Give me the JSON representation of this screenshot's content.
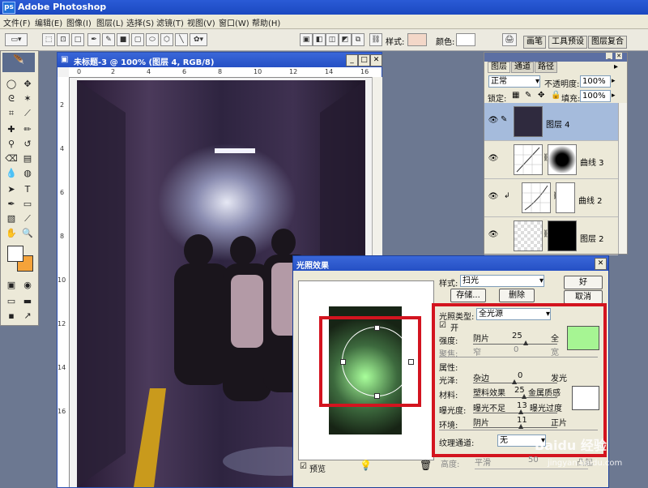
{
  "app": {
    "title": "Adobe Photoshop",
    "icon": "ps"
  },
  "menubar": {
    "items": [
      "文件(F)",
      "编辑(E)",
      "图像(I)",
      "图层(L)",
      "选择(S)",
      "滤镜(T)",
      "视图(V)",
      "窗口(W)",
      "帮助(H)"
    ]
  },
  "options_bar": {
    "style_label": "样式:",
    "color_label": "颜色:",
    "palette_tabs": [
      "画笔",
      "工具预设",
      "图层复合"
    ]
  },
  "document": {
    "title": "未标题-3 @ 100% (图层 4, RGB/8)",
    "ruler_h": [
      "0",
      "2",
      "4",
      "6",
      "8",
      "10",
      "12",
      "14",
      "16"
    ],
    "ruler_v": [
      "2",
      "4",
      "6",
      "8",
      "10",
      "12",
      "14",
      "16"
    ]
  },
  "layers_panel": {
    "tabs": [
      "图层",
      "通道",
      "路径"
    ],
    "blend_mode": "正常",
    "opacity_label": "不透明度:",
    "opacity_value": "100%",
    "lock_label": "锁定:",
    "fill_label": "填充:",
    "fill_value": "100%",
    "layers": [
      {
        "name": "图层 4",
        "selected": true
      },
      {
        "name": "曲线 3",
        "selected": false
      },
      {
        "name": "曲线 2",
        "selected": false
      },
      {
        "name": "图层 2",
        "selected": false
      }
    ]
  },
  "dialog": {
    "title": "光照效果",
    "style_label": "样式:",
    "style_value": "扫光",
    "save_button": "存储...",
    "delete_button": "删除",
    "ok_button": "好",
    "cancel_button": "取消",
    "light_type_label": "光照类型:",
    "light_type_value": "全光源",
    "on_label": "开",
    "intensity_label": "强度:",
    "intensity_left": "阴片",
    "intensity_value": "25",
    "intensity_right": "全",
    "focus_label": "聚焦:",
    "focus_left": "窄",
    "focus_value": "0",
    "focus_right": "宽",
    "properties_label": "属性:",
    "gloss_label": "光泽:",
    "gloss_left": "杂边",
    "gloss_value": "0",
    "gloss_right": "发光",
    "material_label": "材料:",
    "material_left": "塑料效果",
    "material_value": "25",
    "material_right": "金属质感",
    "exposure_label": "曝光度:",
    "exposure_left": "曝光不足",
    "exposure_value": "13",
    "exposure_right": "曝光过度",
    "ambience_label": "环境:",
    "ambience_left": "阴片",
    "ambience_value": "11",
    "ambience_right": "正片",
    "texture_label": "纹理通道:",
    "texture_value": "无",
    "height_label": "高度:",
    "height_left": "平滑",
    "height_value": "50",
    "height_right": "凸起",
    "preview_label": "预览",
    "light_color": "#a6f593",
    "property_color": "#ffffff"
  },
  "watermark": {
    "brand": "Baidu 经验",
    "url": "jingyan.baidu.com"
  }
}
